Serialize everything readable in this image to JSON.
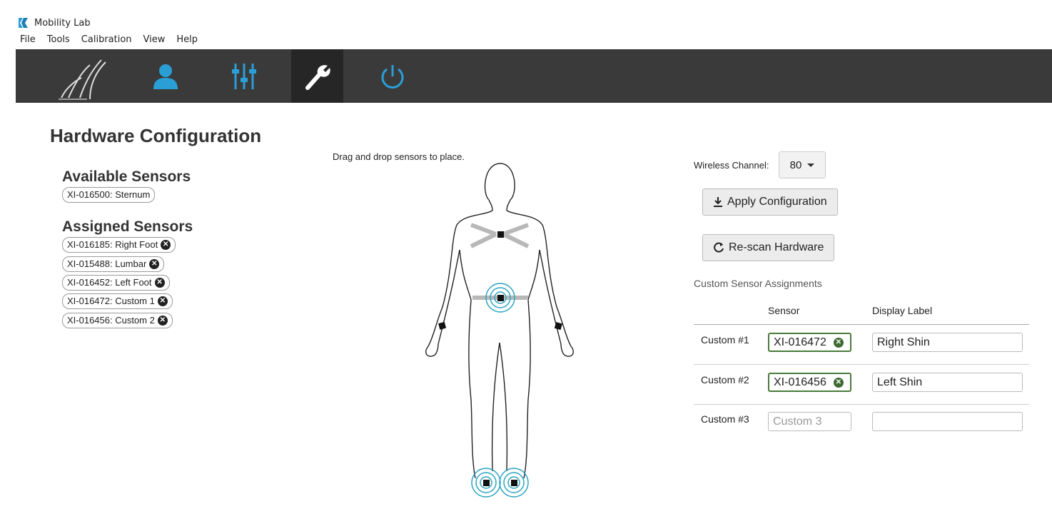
{
  "app": {
    "title": "Mobility Lab",
    "accent": "#2a9fd6"
  },
  "menu": [
    "File",
    "Tools",
    "Calibration",
    "View",
    "Help"
  ],
  "toolbar": {
    "buttons": [
      {
        "name": "walk-logo",
        "icon": "feet-icon",
        "active": false
      },
      {
        "name": "subject",
        "icon": "person-icon",
        "active": false
      },
      {
        "name": "settings",
        "icon": "sliders-icon",
        "active": false
      },
      {
        "name": "hardware",
        "icon": "wrench-icon",
        "active": true
      },
      {
        "name": "power",
        "icon": "power-icon",
        "active": false
      }
    ]
  },
  "page": {
    "title": "Hardware Configuration",
    "available_title": "Available Sensors",
    "available": [
      "XI-016500: Sternum"
    ],
    "assigned_title": "Assigned Sensors",
    "assigned": [
      "XI-016185: Right Foot",
      "XI-015488: Lumbar",
      "XI-016452: Left Foot",
      "XI-016472: Custom 1",
      "XI-016456: Custom 2"
    ],
    "drag_hint": "Drag and drop sensors to place."
  },
  "right": {
    "wireless_label": "Wireless Channel:",
    "wireless_value": "80",
    "apply_label": "Apply Configuration",
    "rescan_label": "Re-scan Hardware",
    "custom_title": "Custom Sensor Assignments",
    "col_sensor": "Sensor",
    "col_display": "Display Label",
    "rows": [
      {
        "label": "Custom #1",
        "sensor": "XI-016472",
        "display": "Right Shin"
      },
      {
        "label": "Custom #2",
        "sensor": "XI-016456",
        "display": "Left Shin"
      },
      {
        "label": "Custom #3",
        "sensor_placeholder": "Custom 3",
        "display": ""
      }
    ]
  }
}
